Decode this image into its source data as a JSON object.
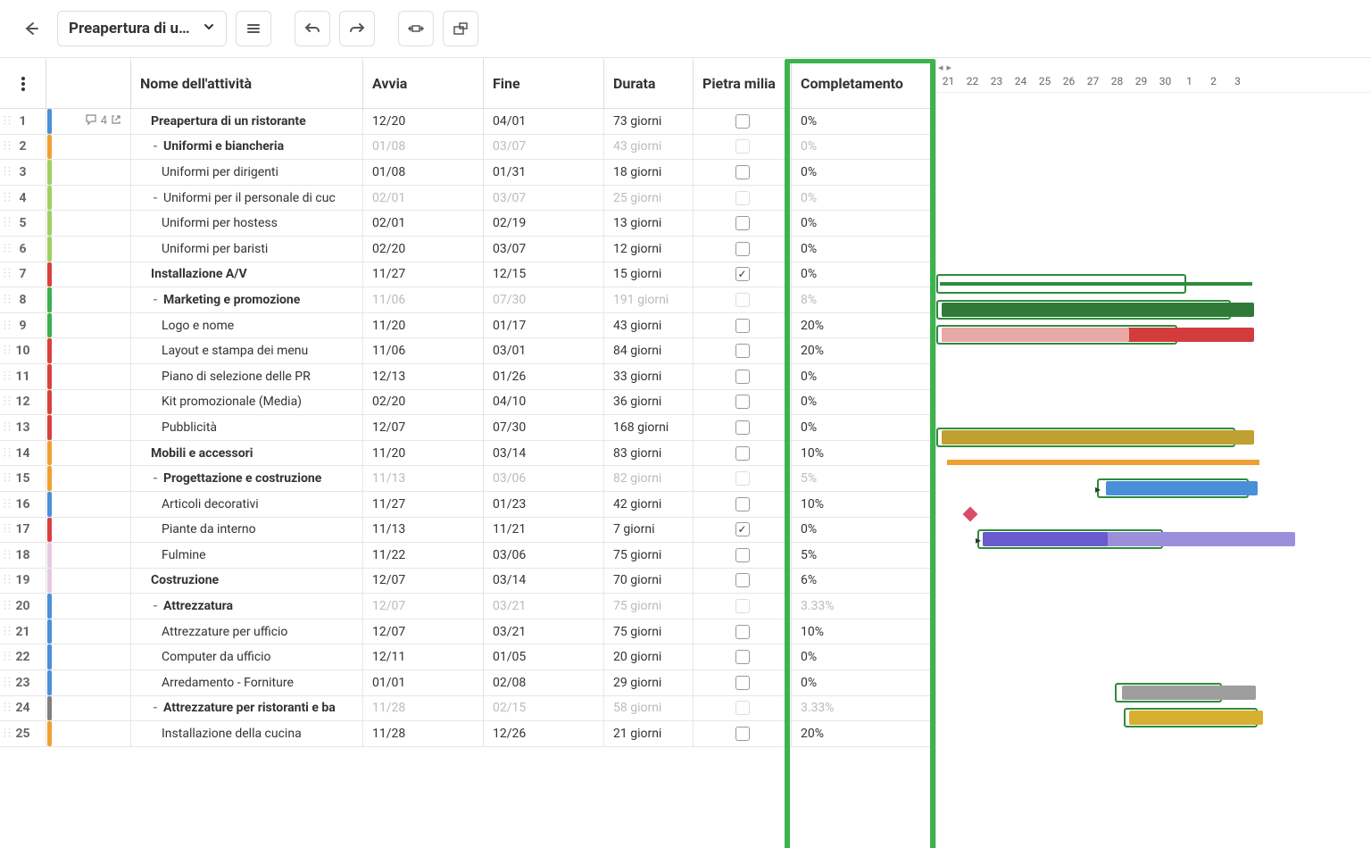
{
  "project_title": "Preapertura di u…",
  "columns": {
    "name": "Nome dell'attività",
    "start": "Avvia",
    "end": "Fine",
    "duration": "Durata",
    "milestone": "Pietra milia",
    "completion": "Completamento"
  },
  "comment_badge": "4",
  "scale": [
    "21",
    "22",
    "23",
    "24",
    "25",
    "26",
    "27",
    "28",
    "29",
    "30",
    "1",
    "2",
    "3"
  ],
  "rows": [
    {
      "num": "1",
      "color": "#4a90d9",
      "name": "Preapertura di un ristorante",
      "bold": true,
      "indent": 1,
      "start": "12/20",
      "end": "04/01",
      "dur": "73 giorni",
      "milestone": false,
      "compl": "0%",
      "faded": false,
      "comments": true
    },
    {
      "num": "2",
      "color": "#f0a030",
      "name": "Uniformi e biancheria",
      "bold": true,
      "indent": 1,
      "toggle": true,
      "start": "01/08",
      "end": "03/07",
      "dur": "43 giorni",
      "milestone": false,
      "compl": "0%",
      "faded": true
    },
    {
      "num": "3",
      "color": "#a0d060",
      "name": "Uniformi per dirigenti",
      "indent": 2,
      "start": "01/08",
      "end": "01/31",
      "dur": "18 giorni",
      "milestone": false,
      "compl": "0%"
    },
    {
      "num": "4",
      "color": "#a0d060",
      "name": "Uniformi per il personale di cuc",
      "indent": 1,
      "toggle": true,
      "start": "02/01",
      "end": "03/07",
      "dur": "25 giorni",
      "milestone": false,
      "compl": "0%",
      "faded": true
    },
    {
      "num": "5",
      "color": "#a0d060",
      "name": "Uniformi per hostess",
      "indent": 2,
      "start": "02/01",
      "end": "02/19",
      "dur": "13 giorni",
      "milestone": false,
      "compl": "0%"
    },
    {
      "num": "6",
      "color": "#a0d060",
      "name": "Uniformi per baristi",
      "indent": 2,
      "start": "02/20",
      "end": "03/07",
      "dur": "12 giorni",
      "milestone": false,
      "compl": "0%"
    },
    {
      "num": "7",
      "color": "#d94040",
      "name": "Installazione A/V",
      "bold": true,
      "indent": 1,
      "start": "11/27",
      "end": "12/15",
      "dur": "15 giorni",
      "milestone": true,
      "compl": "0%"
    },
    {
      "num": "8",
      "color": "#3cb050",
      "name": "Marketing e promozione",
      "bold": true,
      "indent": 1,
      "toggle": true,
      "start": "11/06",
      "end": "07/30",
      "dur": "191 giorni",
      "milestone": false,
      "compl": "8%",
      "faded": true
    },
    {
      "num": "9",
      "color": "#3cb050",
      "name": "Logo e nome",
      "indent": 2,
      "start": "11/20",
      "end": "01/17",
      "dur": "43 giorni",
      "milestone": false,
      "compl": "20%"
    },
    {
      "num": "10",
      "color": "#d94040",
      "name": "Layout e stampa dei menu",
      "indent": 2,
      "start": "11/06",
      "end": "03/01",
      "dur": "84 giorni",
      "milestone": false,
      "compl": "20%"
    },
    {
      "num": "11",
      "color": "#d94040",
      "name": "Piano di selezione delle PR",
      "indent": 2,
      "start": "12/13",
      "end": "01/26",
      "dur": "33 giorni",
      "milestone": false,
      "compl": "0%"
    },
    {
      "num": "12",
      "color": "#d94040",
      "name": "Kit promozionale (Media)",
      "indent": 2,
      "start": "02/20",
      "end": "04/10",
      "dur": "36 giorni",
      "milestone": false,
      "compl": "0%"
    },
    {
      "num": "13",
      "color": "#d94040",
      "name": "Pubblicità",
      "indent": 2,
      "start": "12/07",
      "end": "07/30",
      "dur": "168 giorni",
      "milestone": false,
      "compl": "0%"
    },
    {
      "num": "14",
      "color": "#f0a030",
      "name": "Mobili e accessori",
      "bold": true,
      "indent": 1,
      "start": "11/20",
      "end": "03/14",
      "dur": "83 giorni",
      "milestone": false,
      "compl": "10%"
    },
    {
      "num": "15",
      "color": "#f0a030",
      "name": "Progettazione e costruzione",
      "bold": true,
      "indent": 1,
      "toggle": true,
      "start": "11/13",
      "end": "03/06",
      "dur": "82 giorni",
      "milestone": false,
      "compl": "5%",
      "faded": true
    },
    {
      "num": "16",
      "color": "#4a90d9",
      "name": "Articoli decorativi",
      "indent": 2,
      "start": "11/27",
      "end": "01/23",
      "dur": "42 giorni",
      "milestone": false,
      "compl": "10%"
    },
    {
      "num": "17",
      "color": "#d94040",
      "name": "Piante da interno",
      "indent": 2,
      "start": "11/13",
      "end": "11/21",
      "dur": "7 giorni",
      "milestone": true,
      "compl": "0%"
    },
    {
      "num": "18",
      "color": "#e8c8e0",
      "name": "Fulmine",
      "indent": 2,
      "start": "11/22",
      "end": "03/06",
      "dur": "75 giorni",
      "milestone": false,
      "compl": "5%"
    },
    {
      "num": "19",
      "color": "#e8c8e0",
      "name": "Costruzione",
      "bold": true,
      "indent": 1,
      "start": "12/07",
      "end": "03/14",
      "dur": "70 giorni",
      "milestone": false,
      "compl": "6%"
    },
    {
      "num": "20",
      "color": "#4a90d9",
      "name": "Attrezzatura",
      "bold": true,
      "indent": 1,
      "toggle": true,
      "start": "12/07",
      "end": "03/21",
      "dur": "75 giorni",
      "milestone": false,
      "compl": "3.33%",
      "faded": true
    },
    {
      "num": "21",
      "color": "#4a90d9",
      "name": "Attrezzature per ufficio",
      "indent": 2,
      "start": "12/07",
      "end": "03/21",
      "dur": "75 giorni",
      "milestone": false,
      "compl": "10%"
    },
    {
      "num": "22",
      "color": "#4a90d9",
      "name": "Computer da ufficio",
      "indent": 2,
      "start": "12/11",
      "end": "01/05",
      "dur": "20 giorni",
      "milestone": false,
      "compl": "0%"
    },
    {
      "num": "23",
      "color": "#4a90d9",
      "name": "Arredamento - Forniture",
      "indent": 2,
      "start": "01/01",
      "end": "02/08",
      "dur": "29 giorni",
      "milestone": false,
      "compl": "0%"
    },
    {
      "num": "24",
      "color": "#808080",
      "name": "Attrezzature per ristoranti e ba",
      "bold": true,
      "indent": 1,
      "toggle": true,
      "start": "11/28",
      "end": "02/15",
      "dur": "58 giorni",
      "milestone": false,
      "compl": "3.33%",
      "faded": true
    },
    {
      "num": "25",
      "color": "#f0a030",
      "name": "Installazione della cucina",
      "indent": 2,
      "start": "11/28",
      "end": "12/26",
      "dur": "21 giorni",
      "milestone": false,
      "compl": "20%"
    }
  ]
}
